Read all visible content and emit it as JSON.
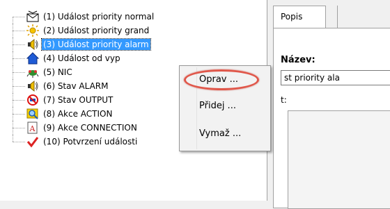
{
  "tree": {
    "items": [
      {
        "label": "(1) Událost priority normal",
        "icon": "envelope-icon"
      },
      {
        "label": "(2) Událost priority grand",
        "icon": "sun-icon"
      },
      {
        "label": "(3) Událost priority alarm",
        "icon": "speaker-alarm-icon",
        "selected": true
      },
      {
        "label": "(4) Událost od vyp",
        "icon": "house-icon"
      },
      {
        "label": "(5) NIC",
        "icon": "bug-icon"
      },
      {
        "label": "(6) Stav ALARM",
        "icon": "speaker-icon"
      },
      {
        "label": "(7) Stav OUTPUT",
        "icon": "prohibited-icon"
      },
      {
        "label": "(8) Akce ACTION",
        "icon": "magnifier-icon"
      },
      {
        "label": "(9) Akce CONNECTION",
        "icon": "document-a-icon"
      },
      {
        "label": "(10) Potvrzení události",
        "icon": "checkmark-icon"
      }
    ]
  },
  "right_panel": {
    "tab_label": "Popis",
    "name_label": "Název:",
    "name_value": "st priority ala",
    "second_label": "t:"
  },
  "context_menu": {
    "items": [
      "Oprav ...",
      "Přidej ...",
      "Vymaž ..."
    ],
    "highlighted": "Oprav ...",
    "highlight_color": "#e0574a"
  },
  "colors": {
    "selection": "#3399ff",
    "panel_bg": "#f0f0f0"
  }
}
